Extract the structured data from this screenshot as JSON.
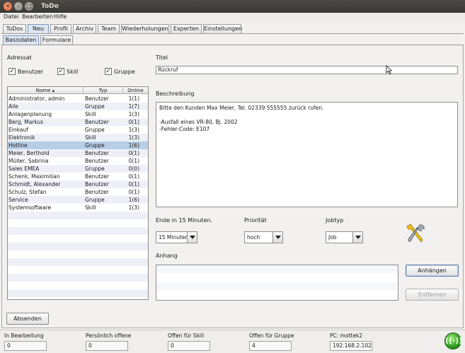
{
  "window": {
    "title": "ToDo"
  },
  "menu": {
    "items": [
      "Datei",
      "Bearbeiten",
      "Hilfe"
    ]
  },
  "main_tabs": [
    "ToDos",
    "Neu",
    "Profil",
    "Archiv",
    "Team",
    "Wiederholungen",
    "Experten",
    "Einstellungen"
  ],
  "sub_tabs": [
    "Basisdaten",
    "Formulare"
  ],
  "adressat": {
    "label": "Adressat",
    "filters": [
      {
        "label": "Benutzer",
        "checked": true
      },
      {
        "label": "Skill",
        "checked": true
      },
      {
        "label": "Gruppe",
        "checked": true
      }
    ],
    "columns": [
      "Name",
      "Typ",
      "Online"
    ],
    "rows": [
      {
        "name": "Administrator, admin",
        "typ": "Benutzer",
        "online": "1(1)"
      },
      {
        "name": "Alle",
        "typ": "Gruppe",
        "online": "1(7)"
      },
      {
        "name": "Anlagenplanung",
        "typ": "Skill",
        "online": "1(3)"
      },
      {
        "name": "Berg, Markus",
        "typ": "Benutzer",
        "online": "0(1)"
      },
      {
        "name": "Einkauf",
        "typ": "Gruppe",
        "online": "1(3)"
      },
      {
        "name": "Elektronik",
        "typ": "Skill",
        "online": "1(3)"
      },
      {
        "name": "Hotline",
        "typ": "Gruppe",
        "online": "1(6)"
      },
      {
        "name": "Meier, Berthold",
        "typ": "Benutzer",
        "online": "0(1)"
      },
      {
        "name": "Müller, Sabrina",
        "typ": "Benutzer",
        "online": "0(1)"
      },
      {
        "name": "Sales EMEA",
        "typ": "Gruppe",
        "online": "0(0)"
      },
      {
        "name": "Schenk, Maximilian",
        "typ": "Benutzer",
        "online": "0(1)"
      },
      {
        "name": "Schmidt, Alexander",
        "typ": "Benutzer",
        "online": "0(1)"
      },
      {
        "name": "Schulz, Stefan",
        "typ": "Benutzer",
        "online": "0(1)"
      },
      {
        "name": "Service",
        "typ": "Gruppe",
        "online": "1(6)"
      },
      {
        "name": "Systemsoftware",
        "typ": "Skill",
        "online": "1(3)"
      }
    ],
    "selected_row": "Hotline"
  },
  "titel": {
    "label": "Titel",
    "value": "Rückruf"
  },
  "beschreibung": {
    "label": "Beschreibung",
    "lines": [
      "Bitte den Kunden Max Meier, Tel. 02339 555555 zurück rufen.",
      "",
      "-Ausfall eines VR-80, Bj. 2002",
      "-Fehler-Code: E107"
    ]
  },
  "ende": {
    "label": "Ende in 15 Minuten.",
    "value": "15 Minuten"
  },
  "prioritaet": {
    "label": "Priorität",
    "value": "hoch"
  },
  "jobtyp": {
    "label": "Jobtyp",
    "value": "Job"
  },
  "anhang": {
    "label": "Anhang"
  },
  "buttons": {
    "anhaengen": "Anhängen",
    "entfernen": "Entfernen",
    "absenden": "Absenden"
  },
  "status": {
    "in_bearbeitung": {
      "label": "In Bearbeitung",
      "value": "0"
    },
    "persoenlich_offene": {
      "label": "Persönlich offene",
      "value": "0"
    },
    "offen_skill": {
      "label": "Offen für Skill",
      "value": "0"
    },
    "offen_gruppe": {
      "label": "Offen für Gruppe",
      "value": "4"
    },
    "pc": {
      "label": "PC: mottek2",
      "value": "192.168.2.102"
    }
  },
  "icons": {
    "tools": "tools-icon",
    "connection": "connection-status-icon"
  },
  "colors": {
    "selection": "#b8cde6",
    "connection_ok": "#2e9a1e"
  }
}
